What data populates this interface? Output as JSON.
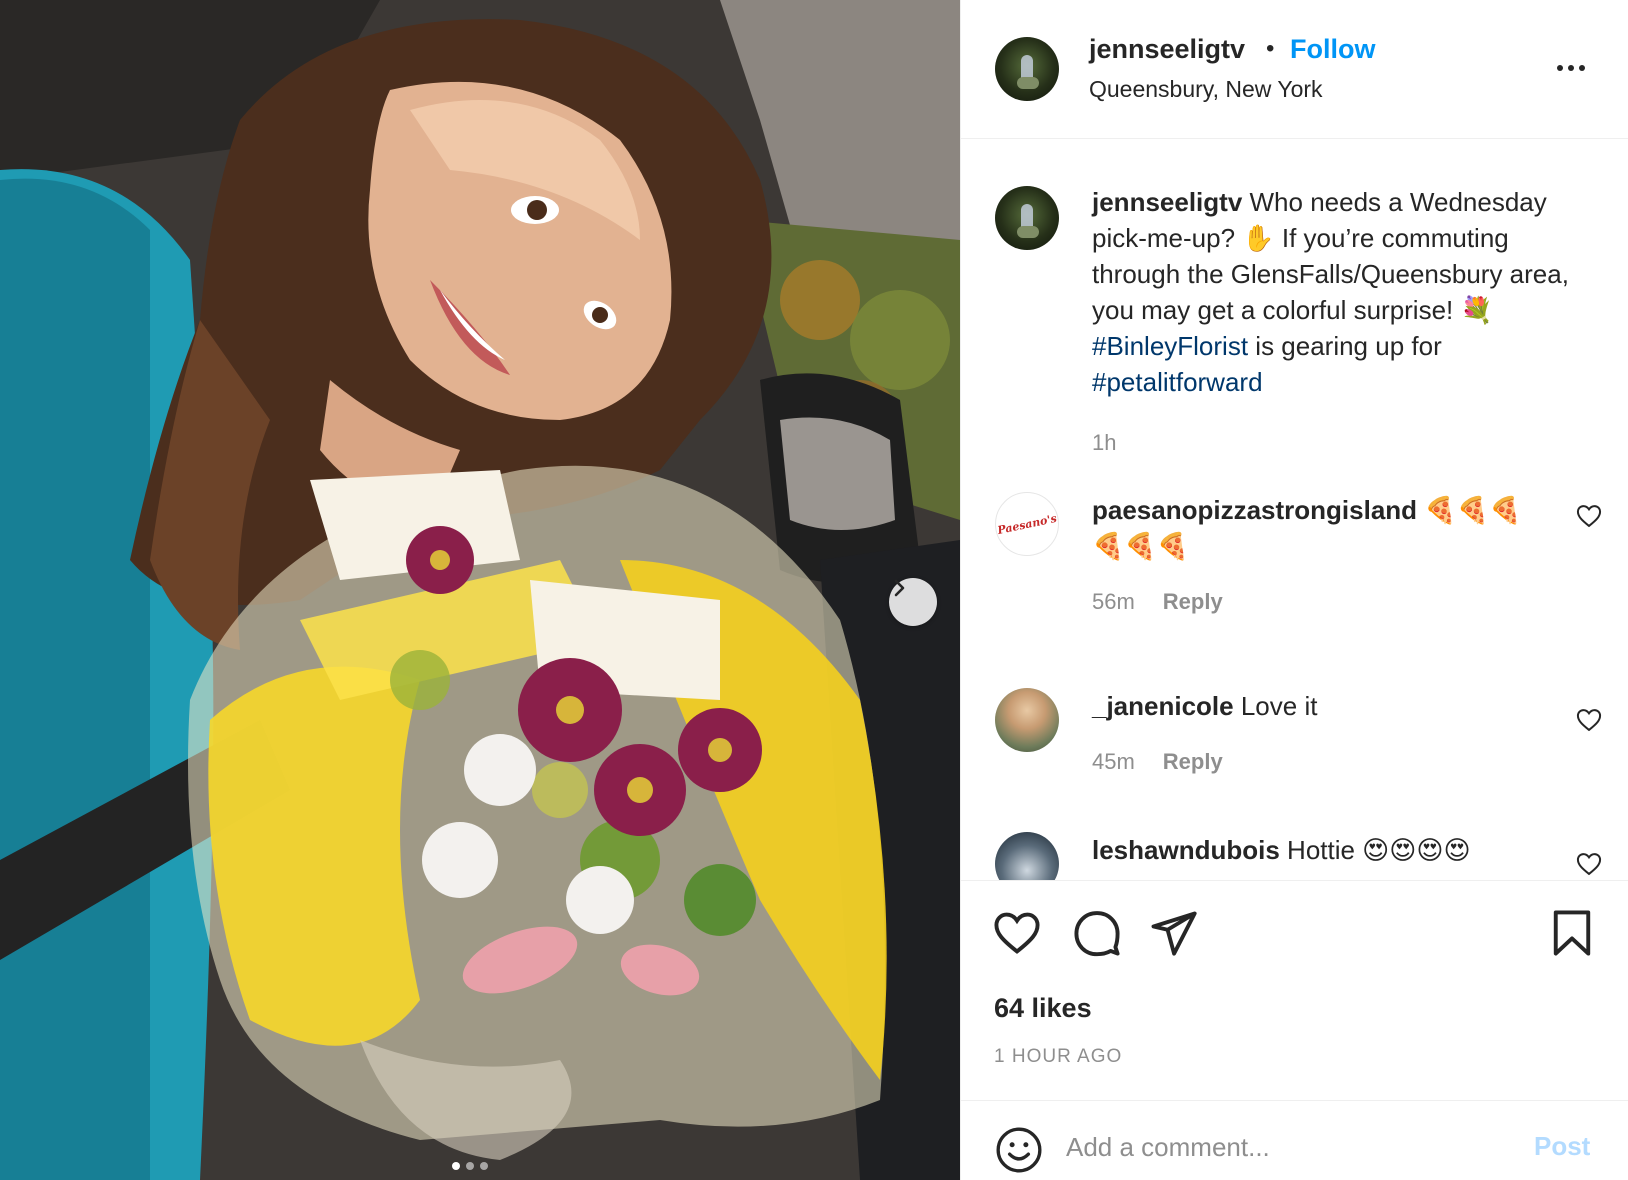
{
  "post": {
    "username": "jennseeligtv",
    "separator": "•",
    "follow_label": "Follow",
    "location": "Queensbury, New York",
    "more_icon": "more-horizontal-icon"
  },
  "caption": {
    "username": "jennseeligtv",
    "text_1": " Who needs a Wednesday pick-me-up? ✋ If you’re commuting through the GlensFalls/Queensbury area, you may get a colorful surprise! 💐 ",
    "hashtag_1": "#BinleyFlorist",
    "text_2": " is gearing up for ",
    "hashtag_2": "#petalitforward",
    "timestamp": "1h"
  },
  "comments": [
    {
      "username": "paesanopizzastrongisland",
      "text": " 🍕🍕🍕🍕🍕🍕",
      "time": "56m",
      "reply_label": "Reply",
      "avatar_text": "Paesano's"
    },
    {
      "username": "_janenicole",
      "text": " Love it",
      "time": "45m",
      "reply_label": "Reply"
    },
    {
      "username": "leshawndubois",
      "text": " Hottie 😍😍😍😍",
      "time": "",
      "reply_label": ""
    }
  ],
  "actions": {
    "like_icon": "heart-icon",
    "comment_icon": "comment-icon",
    "share_icon": "paper-plane-icon",
    "save_icon": "bookmark-icon",
    "likes": "64 likes",
    "time_ago": "1 HOUR AGO"
  },
  "add_comment": {
    "placeholder": "Add a comment...",
    "post_label": "Post",
    "emoji_icon": "smiley-icon"
  },
  "carousel": {
    "next_icon": "chevron-right-icon",
    "slide_count": 3,
    "active_slide": 1
  },
  "colors": {
    "accent": "#0095f6",
    "hashtag": "#00376b",
    "muted": "#8e8e8e",
    "post_disabled": "#b3dbff"
  }
}
